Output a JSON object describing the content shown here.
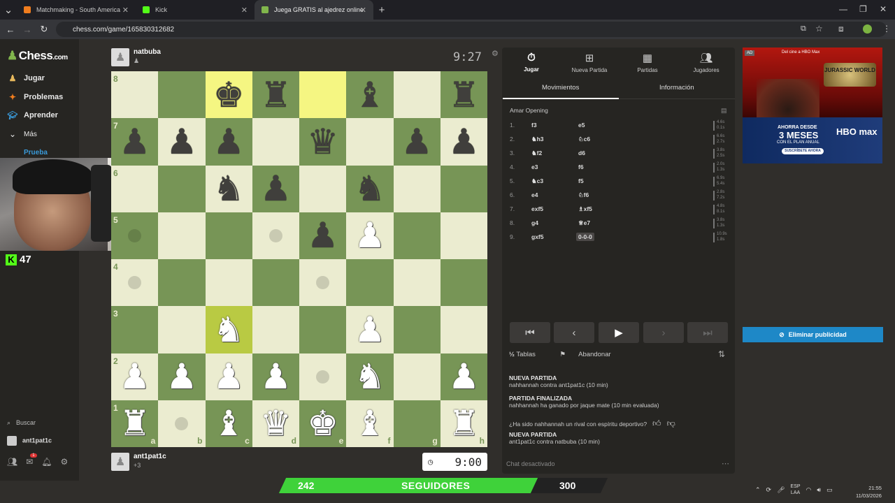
{
  "browser": {
    "tabs": [
      {
        "label": "Matchmaking - South America",
        "icon_color": "#f07d1e"
      },
      {
        "label": "Kick",
        "icon_color": "#53fc18"
      },
      {
        "label": "Juega GRATIS al ajedrez online",
        "icon_color": "#81b64c"
      }
    ],
    "url": "chess.com/game/165830312682"
  },
  "sidebar": {
    "logo": "Chess",
    "logo_suffix": ".com",
    "items": [
      "Jugar",
      "Problemas",
      "Aprender",
      "Más",
      "Prueba"
    ],
    "search": "Buscar",
    "username": "ant1pat1c",
    "notification_count": "1"
  },
  "stream": {
    "kick_count": "47"
  },
  "game": {
    "top_player": {
      "name": "natbuba",
      "clock": "9:27"
    },
    "bottom_player": {
      "name": "ant1pat1c",
      "sub": "+3",
      "clock": "9:00"
    },
    "board": [
      [
        "",
        "",
        "bk",
        "br",
        "",
        "bb",
        "",
        "br"
      ],
      [
        "bp",
        "bp",
        "bp",
        "",
        "bq",
        "",
        "bp",
        "bp"
      ],
      [
        "",
        "",
        "bn",
        "bp",
        "",
        "bn",
        "",
        ""
      ],
      [
        "",
        "",
        "",
        "",
        "bp",
        "wp",
        "",
        ""
      ],
      [
        "",
        "",
        "",
        "",
        "",
        "",
        "",
        ""
      ],
      [
        "",
        "",
        "wn",
        "",
        "",
        "wp",
        "",
        ""
      ],
      [
        "wp",
        "wp",
        "wp",
        "wp",
        "",
        "wn",
        "",
        "wp"
      ],
      [
        "wr",
        "",
        "wb",
        "wq",
        "wk",
        "wb",
        "",
        "wr"
      ]
    ],
    "highlights": [
      [
        0,
        2
      ],
      [
        0,
        4
      ],
      [
        5,
        2
      ]
    ],
    "dots": [
      [
        3,
        0
      ],
      [
        3,
        3
      ],
      [
        4,
        0
      ],
      [
        4,
        4
      ],
      [
        6,
        4
      ],
      [
        7,
        1
      ]
    ],
    "ranks": [
      "8",
      "7",
      "6",
      "5",
      "4",
      "3",
      "2",
      "1"
    ],
    "files": [
      "a",
      "b",
      "c",
      "d",
      "e",
      "f",
      "g",
      "h"
    ]
  },
  "panel": {
    "tabs": [
      "Jugar",
      "Nueva Partida",
      "Partidas",
      "Jugadores"
    ],
    "subtabs": [
      "Movimientos",
      "Información"
    ],
    "opening": "Amar Opening",
    "moves": [
      {
        "n": "1.",
        "w": "f3",
        "b": "e5",
        "t1": "4.6s",
        "t2": "0.1s"
      },
      {
        "n": "2.",
        "w": "♞h3",
        "b": "♘c6",
        "t1": "6.6s",
        "t2": "2.7s"
      },
      {
        "n": "3.",
        "w": "♞f2",
        "b": "d6",
        "t1": "3.8s",
        "t2": "2.5s"
      },
      {
        "n": "4.",
        "w": "e3",
        "b": "f6",
        "t1": "2.0s",
        "t2": "1.3s"
      },
      {
        "n": "5.",
        "w": "♞c3",
        "b": "f5",
        "t1": "6.9s",
        "t2": "5.4s"
      },
      {
        "n": "6.",
        "w": "e4",
        "b": "♘f6",
        "t1": "2.8s",
        "t2": "7.2s"
      },
      {
        "n": "7.",
        "w": "exf5",
        "b": "♗xf5",
        "t1": "4.8s",
        "t2": "8.1s"
      },
      {
        "n": "8.",
        "w": "g4",
        "b": "♕e7",
        "t1": "3.8s",
        "t2": "1.3s"
      },
      {
        "n": "9.",
        "w": "gxf5",
        "b": "0-0-0",
        "t1": "10.9s",
        "t2": "1.8s"
      }
    ],
    "actions": {
      "draw": "Tablas",
      "resign": "Abandonar"
    },
    "chat": [
      {
        "title": "NUEVA PARTIDA",
        "line": "nahhannah contra ant1pat1c (10 min)"
      },
      {
        "title": "PARTIDA FINALIZADA",
        "line": "nahhannah ha ganado por jaque mate (10 min evaluada)"
      },
      {
        "title": "",
        "line": "¿Ha sido nahhannah un rival con espíritu deportivo?"
      },
      {
        "title": "NUEVA PARTIDA",
        "line": "ant1pat1c contra natbuba (10 min)"
      }
    ],
    "chat_disabled": "Chat desactivado"
  },
  "ad": {
    "tag": "AD",
    "top_line": "Del cine a HBO Max",
    "brand": "JURASSIC WORLD",
    "offer_line1": "AHORRA DESDE",
    "offer_line2": "3 MESES",
    "offer_line3": "CON EL PLAN ANUAL",
    "hbo": "HBO max",
    "cta": "SUSCRÍBETE AHORA",
    "remove": "Eliminar publicidad"
  },
  "overlay": {
    "current": "242",
    "label": "SEGUIDORES",
    "goal": "300",
    "progress": 0.807
  },
  "tray": {
    "lang1": "ESP",
    "lang2": "LAA",
    "time": "21:55",
    "date": "11/03/2026"
  }
}
